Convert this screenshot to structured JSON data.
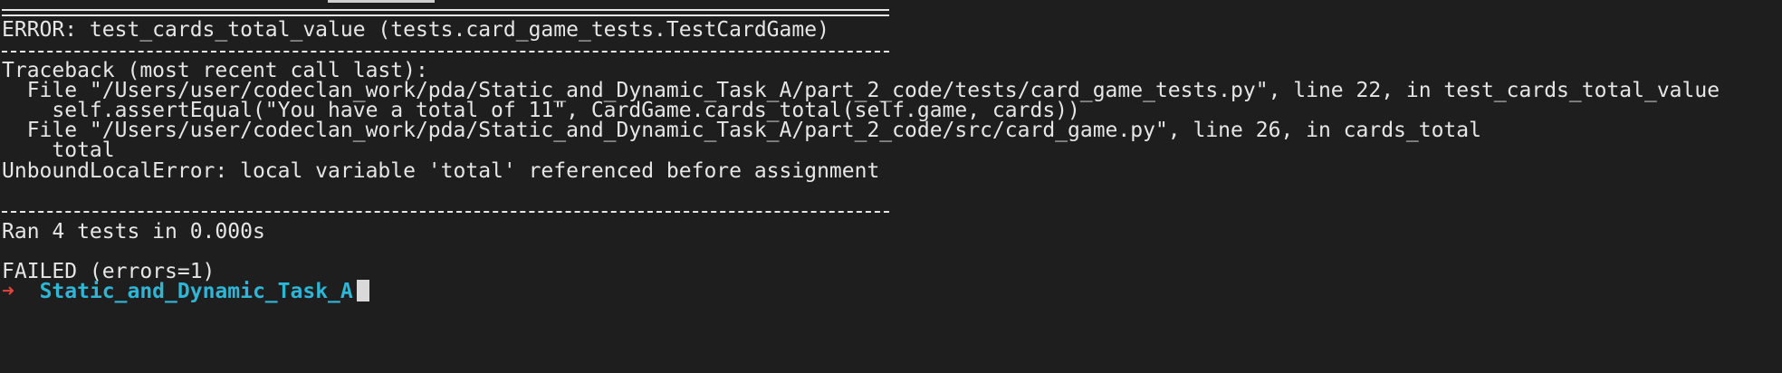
{
  "terminal": {
    "error_header": "ERROR: test_cards_total_value (tests.card_game_tests.TestCardGame)",
    "traceback_header": "Traceback (most recent call last):",
    "trace": [
      "  File \"/Users/user/codeclan_work/pda/Static_and_Dynamic_Task_A/part_2_code/tests/card_game_tests.py\", line 22, in test_cards_total_value",
      "    self.assertEqual(\"You have a total of 11\", CardGame.cards_total(self.game, cards))",
      "  File \"/Users/user/codeclan_work/pda/Static_and_Dynamic_Task_A/part_2_code/src/card_game.py\", line 26, in cards_total",
      "    total"
    ],
    "exception": "UnboundLocalError: local variable 'total' referenced before assignment",
    "summary": "Ran 4 tests in 0.000s",
    "result": "FAILED (errors=1)",
    "prompt": {
      "arrow": "➜",
      "directory": "Static_and_Dynamic_Task_A"
    }
  },
  "colors": {
    "background": "#1e1e1e",
    "text": "#e6e6e6",
    "prompt_arrow": "#e0443e",
    "prompt_directory": "#2fb5d6"
  }
}
